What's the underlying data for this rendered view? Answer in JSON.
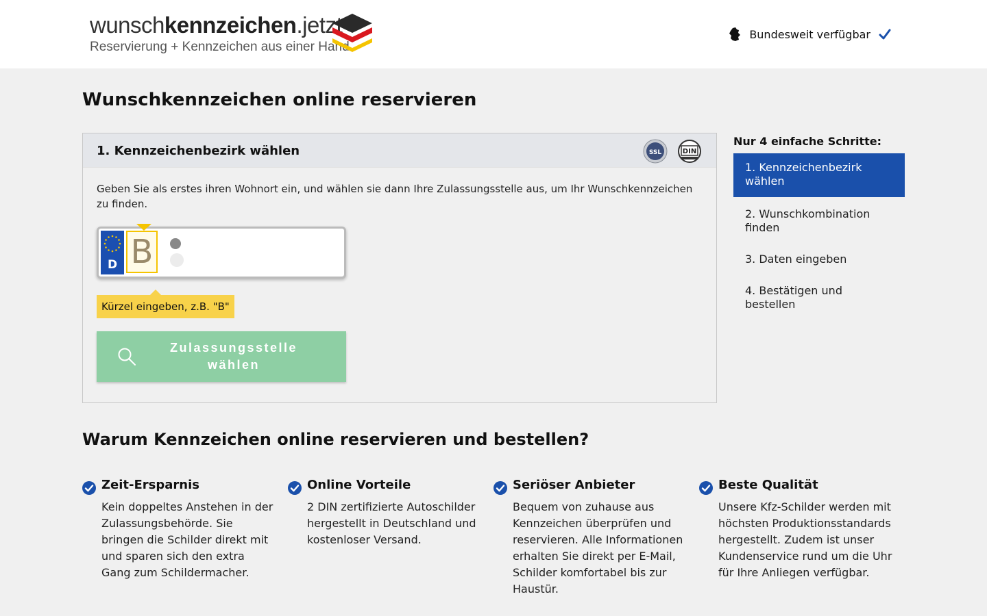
{
  "header": {
    "logo_prefix": "wunsch",
    "logo_bold": "kennzeichen",
    "logo_suffix": ".jetzt",
    "logo_tagline": "Reservierung + Kennzeichen aus einer Hand",
    "availability": "Bundesweit verfügbar"
  },
  "page": {
    "title": "Wunschkennzeichen online reservieren"
  },
  "panel": {
    "title": "1. Kennzeichenbezirk wählen",
    "badges": [
      "SSL",
      "DIN"
    ],
    "description": "Geben Sie als erstes ihren Wohnort ein, und wählen sie dann Ihre Zulassungsstelle aus, um Ihr Wunschkennzeichen zu finden.",
    "plate": {
      "country": "D",
      "district_value": "B"
    },
    "tooltip": "Kürzel eingeben, z.B. \"B\"",
    "button_line1": "Zulassungsstelle",
    "button_line2": "wählen"
  },
  "steps": {
    "title": "Nur 4 einfache Schritte:",
    "items": [
      {
        "label": "1. Kennzeichenbezirk wählen",
        "active": true
      },
      {
        "label": "2. Wunschkombination finden",
        "active": false
      },
      {
        "label": "3. Daten eingeben",
        "active": false
      },
      {
        "label": "4. Bestätigen und bestellen",
        "active": false
      }
    ]
  },
  "why": {
    "title": "Warum Kennzeichen online reservieren und bestellen?",
    "features": [
      {
        "title": "Zeit-Ersparnis",
        "text": "Kein doppeltes Anstehen in der Zulassungsbehörde. Sie bringen die Schilder direkt mit und sparen sich den extra Gang zum Schildermacher."
      },
      {
        "title": "Online Vorteile",
        "text": "2 DIN zertifizierte Autoschilder hergestellt in Deutschland und kostenloser Versand."
      },
      {
        "title": "Seriöser Anbieter",
        "text": "Bequem von zuhause aus Kennzeichen überprüfen und reservieren. Alle Informationen erhalten Sie direkt per E-Mail, Schilder komfortabel bis zur Haustür."
      },
      {
        "title": "Beste Qualität",
        "text": "Unsere Kfz-Schilder werden mit höchsten Produktionsstandards hergestellt. Zudem ist unser Kundenservice rund um die Uhr für Ihre Anliegen verfügbar."
      }
    ]
  },
  "colors": {
    "primary_blue": "#1a50ab",
    "button_green": "#8ecfa4",
    "tooltip_yellow": "#f8d24a",
    "plate_yellow": "#f5c400"
  },
  "icons": [
    "germany-map-icon",
    "checkmark-icon",
    "search-icon",
    "eu-stars-icon",
    "check-circle-icon",
    "ssl-badge-icon",
    "din-badge-icon"
  ]
}
